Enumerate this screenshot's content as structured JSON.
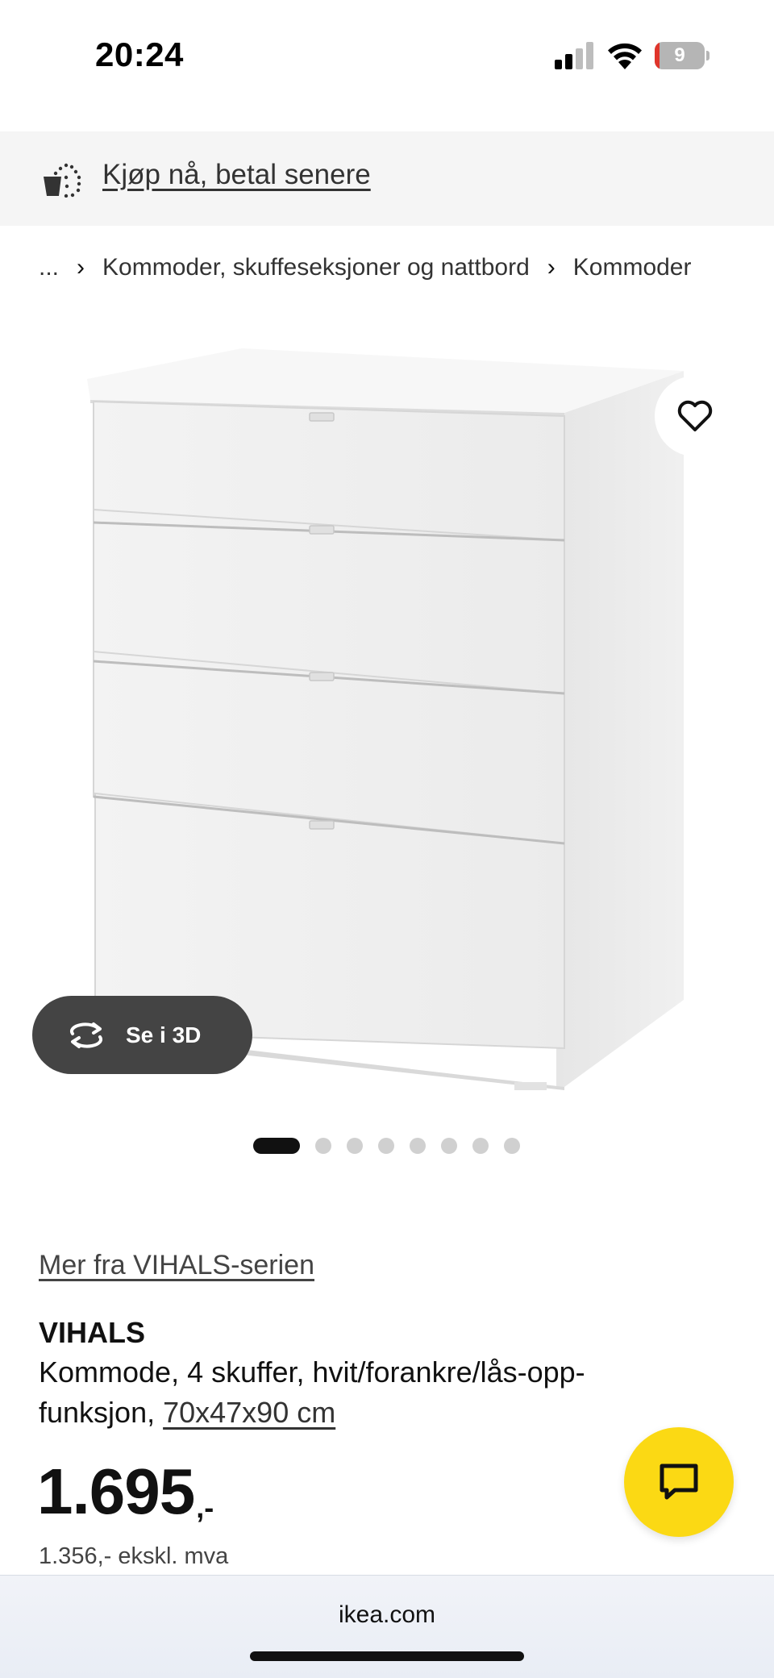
{
  "status_bar": {
    "time": "20:24",
    "battery_level": "9",
    "battery_fraction": 0.09,
    "icons": [
      "signal-icon",
      "wifi-icon",
      "battery-icon"
    ]
  },
  "banner": {
    "icon": "pay-later-icon",
    "text": "Kjøp nå, betal senere"
  },
  "breadcrumb": {
    "items": [
      "...",
      "Kommoder, skuffeseksjoner og nattbord",
      "Kommoder"
    ],
    "separator_icon": "chevron-right-icon"
  },
  "gallery": {
    "favorite_icon": "heart-icon",
    "view_3d_icon": "rotate-3d-icon",
    "view_3d_label": "Se i 3D",
    "dot_count": 8,
    "active_index": 0
  },
  "product": {
    "series_link": "Mer fra VIHALS-serien",
    "name": "VIHALS",
    "description": "Kommode, 4 skuffer, hvit/forankre/lås-opp-funksjon, ",
    "dimensions": "70x47x90 cm",
    "price": "1.695",
    "price_suffix": ",-",
    "price_excl_vat": "1.356,- ekskl. mva"
  },
  "chat": {
    "icon": "chat-icon"
  },
  "browser": {
    "url": "ikea.com"
  },
  "colors": {
    "chat_button": "#fbd914",
    "banner_bg": "#f5f5f5",
    "button_3d_bg": "#444444",
    "battery_low": "#e0352b"
  }
}
